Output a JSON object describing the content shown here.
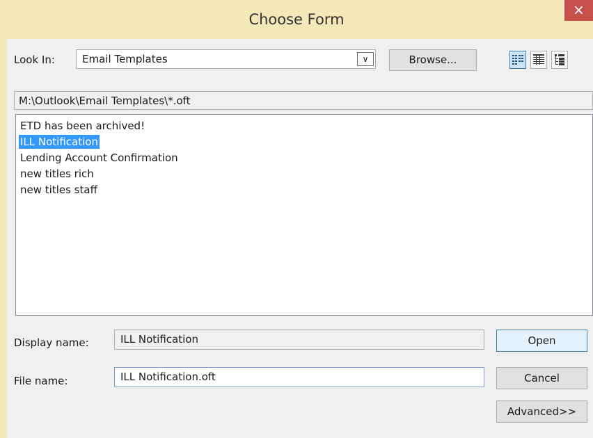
{
  "window": {
    "title": "Choose Form",
    "close_glyph": "×"
  },
  "look_in": {
    "label": "Look In:",
    "value": "Email Templates",
    "dropdown_glyph": "∨",
    "browse_label": "Browse..."
  },
  "view_buttons": [
    {
      "icon": "list-view-icon",
      "active": true
    },
    {
      "icon": "details-view-icon",
      "active": false
    },
    {
      "icon": "tree-view-icon",
      "active": false
    }
  ],
  "path": "M:\\Outlook\\Email Templates\\*.oft",
  "forms": {
    "items": [
      "ETD has been archived!",
      "ILL Notification",
      "Lending Account Confirmation",
      "new titles rich",
      "new titles staff"
    ],
    "selected_index": 1
  },
  "display_name": {
    "label": "Display name:",
    "value": "ILL Notification"
  },
  "file_name": {
    "label": "File name:",
    "value": "ILL Notification.oft"
  },
  "buttons": {
    "open": "Open",
    "cancel": "Cancel",
    "advanced": "Advanced>>"
  }
}
